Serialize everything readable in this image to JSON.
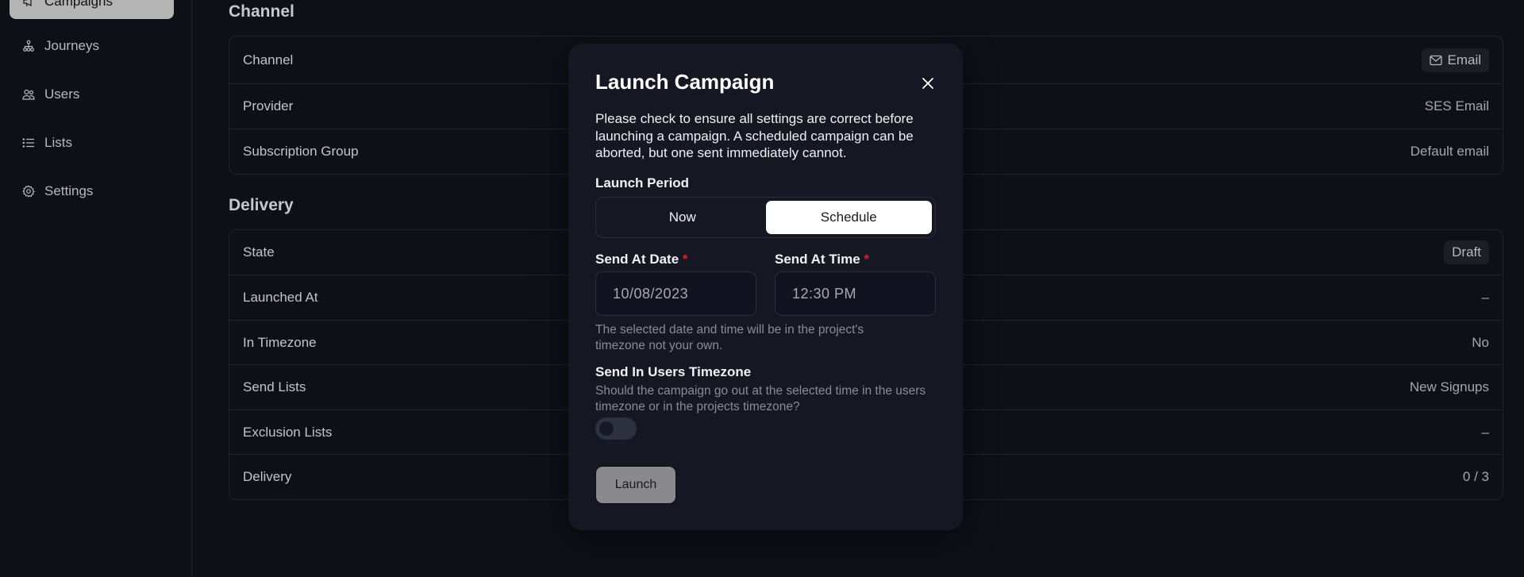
{
  "sidebar": {
    "items": [
      {
        "label": "Campaigns",
        "icon": "megaphone-icon",
        "active": true
      },
      {
        "label": "Journeys",
        "icon": "journey-tree-icon",
        "active": false
      },
      {
        "label": "Users",
        "icon": "users-icon",
        "active": false
      },
      {
        "label": "Lists",
        "icon": "list-icon",
        "active": false
      },
      {
        "label": "Settings",
        "icon": "gear-icon",
        "active": false
      }
    ]
  },
  "main": {
    "channel_section": {
      "title": "Channel",
      "rows": [
        {
          "label": "Channel",
          "value": "Email",
          "badge": true,
          "icon": "mail-icon"
        },
        {
          "label": "Provider",
          "value": "SES Email"
        },
        {
          "label": "Subscription Group",
          "value": "Default email"
        }
      ]
    },
    "delivery_section": {
      "title": "Delivery",
      "rows": [
        {
          "label": "State",
          "value": "Draft",
          "badge": true
        },
        {
          "label": "Launched At",
          "value": "–"
        },
        {
          "label": "In Timezone",
          "value": "No"
        },
        {
          "label": "Send Lists",
          "value": "New Signups"
        },
        {
          "label": "Exclusion Lists",
          "value": "–"
        },
        {
          "label": "Delivery",
          "value": "0 / 3"
        }
      ]
    }
  },
  "modal": {
    "title": "Launch Campaign",
    "close_icon": "close-icon",
    "description": "Please check to ensure all settings are correct before launching a campaign. A scheduled campaign can be aborted, but one sent immediately cannot.",
    "launch_period": {
      "label": "Launch Period",
      "options": [
        "Now",
        "Schedule"
      ],
      "selected": "Schedule"
    },
    "send_at_date": {
      "label": "Send At Date",
      "required_mark": "*",
      "value": "10/08/2023"
    },
    "send_at_time": {
      "label": "Send At Time",
      "required_mark": "*",
      "value": "12:30 PM"
    },
    "datetime_help": "The selected date and time will be in the project's timezone not your own.",
    "users_timezone": {
      "label": "Send In Users Timezone",
      "help": "Should the campaign go out at the selected time in the users timezone or in the projects timezone?",
      "enabled": false
    },
    "launch_label": "Launch"
  }
}
